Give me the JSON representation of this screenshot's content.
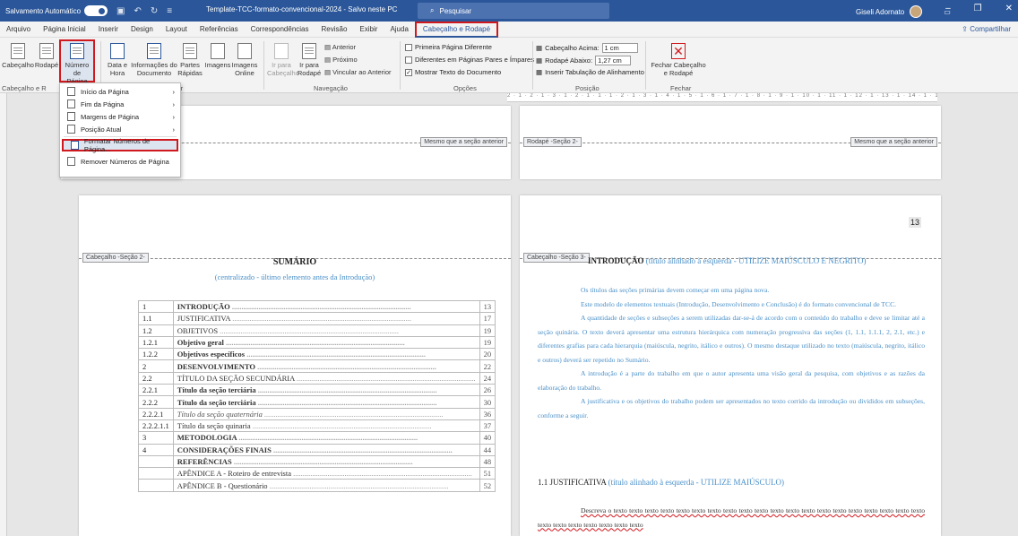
{
  "titlebar": {
    "autosave": "Salvamento Automático",
    "toggle": "Ligado",
    "doc": "Template-TCC-formato-convencional-2024 - Salvo neste PC",
    "search": "Pesquisar",
    "user": "Giseli Adornato"
  },
  "menu": {
    "tabs": [
      "Arquivo",
      "Página Inicial",
      "Inserir",
      "Design",
      "Layout",
      "Referências",
      "Correspondências",
      "Revisão",
      "Exibir",
      "Ajuda"
    ],
    "active": "Cabeçalho e Rodapé",
    "share": "Compartilhar"
  },
  "ribbon": {
    "cabecalho": "Cabeçalho",
    "rodape": "Rodapé",
    "numero": "Número de Página",
    "data": "Data e Hora",
    "info": "Informações do Documento",
    "partes": "Partes Rápidas",
    "imagens": "Imagens",
    "imagens_online": "Imagens Online",
    "ir_cab": "Ir para Cabeçalho",
    "ir_rod": "Ir para Rodapé",
    "anterior": "Anterior",
    "proximo": "Próximo",
    "vincular": "Vincular ao Anterior",
    "primeira": "Primeira Página Diferente",
    "pares": "Diferentes em Páginas Pares e Ímpares",
    "mostrar": "Mostrar Texto do Documento",
    "cab_acima": "Cabeçalho Acima:",
    "cab_val": "1 cm",
    "rod_abaixo": "Rodapé Abaixo:",
    "rod_val": "1,27 cm",
    "tabulacao": "Inserir Tabulação de Alinhamento",
    "fechar": "Fechar Cabeçalho e Rodapé",
    "groups": {
      "g1": "Cabeçalho e R",
      "g2": "ir",
      "nav": "Navegação",
      "opc": "Opções",
      "pos": "Posição",
      "fech": "Fechar"
    }
  },
  "dropdown": [
    "Início da Página",
    "Fim da Página",
    "Margens de Página",
    "Posição Atual",
    "Formatar Números de Página...",
    "Remover Números de Página"
  ],
  "left_page": {
    "tag_top": "Mesmo que a seção anterior",
    "tag_header": "Cabeçalho -Seção 2-",
    "title": "SUMÁRIO",
    "subtitle": "(centralizado - último elemento antes da Introdução)"
  },
  "toc": [
    {
      "n": "1",
      "t": "INTRODUÇÃO",
      "p": "13",
      "s": "b"
    },
    {
      "n": "1.1",
      "t": "JUSTIFICATIVA",
      "p": "17",
      "s": ""
    },
    {
      "n": "1.2",
      "t": "OBJETIVOS",
      "p": "19",
      "s": ""
    },
    {
      "n": "1.2.1",
      "t": "Objetivo geral",
      "p": "19",
      "s": "b"
    },
    {
      "n": "1.2.2",
      "t": "Objetivos específicos",
      "p": "20",
      "s": "b"
    },
    {
      "n": "2",
      "t": "DESENVOLVIMENTO",
      "p": "22",
      "s": "b"
    },
    {
      "n": "2.2",
      "t": "TÍTULO DA SEÇÃO SECUNDÁRIA",
      "p": "24",
      "s": ""
    },
    {
      "n": "2.2.1",
      "t": "Título da seção terciária",
      "p": "26",
      "s": "b"
    },
    {
      "n": "2.2.2",
      "t": "Título da seção terciária",
      "p": "30",
      "s": "b"
    },
    {
      "n": "2.2.2.1",
      "t": "Título da seção quaternária",
      "p": "36",
      "s": "i"
    },
    {
      "n": "2.2.2.1.1",
      "t": "Título da seção quinaria",
      "p": "37",
      "s": ""
    },
    {
      "n": "3",
      "t": "METODOLOGIA",
      "p": "40",
      "s": "b"
    },
    {
      "n": "4",
      "t": "CONSIDERAÇÕES FINAIS",
      "p": "44",
      "s": "b"
    },
    {
      "n": "",
      "t": "REFERÊNCIAS",
      "p": "48",
      "s": "b"
    },
    {
      "n": "",
      "t": "APÊNDICE A - Roteiro de entrevista",
      "p": "51",
      "s": ""
    },
    {
      "n": "",
      "t": "APÊNDICE B - Questionário",
      "p": "52",
      "s": ""
    }
  ],
  "right_page": {
    "tag_footer": "Rodapé -Seção 2-",
    "tag_same": "Mesmo que a seção anterior",
    "page_num": "13",
    "tag_header": "Cabeçalho -Seção 3-",
    "intro_title": "INTRODUÇÃO",
    "intro_note": "(título alinhado à esquerda - UTILIZE MAIÚSCULO E NEGRITO)",
    "p1": "Os títulos das seções primárias devem começar em uma página nova.",
    "p2": "Este modelo de elementos textuais (Introdução, Desenvolvimento e Conclusão) é do formato convencional de TCC.",
    "p3": "A quantidade de seções e subseções a serem utilizadas dar-se-á de acordo com o conteúdo do trabalho e deve se limitar até a seção quinária. O texto deverá apresentar uma estrutura hierárquica com numeração progressiva das seções (1, 1.1, 1.1.1, 2, 2.1, etc.) e diferentes grafias para cada hierarquia (maiúscula, negrito, itálico e outros). O mesmo destaque utilizado no texto (maiúscula, negrito, itálico e outros) deverá ser repetido no Sumário.",
    "p4": "A introdução é a parte do trabalho em que o autor apresenta uma visão geral da pesquisa, com objetivos e as razões da elaboração do trabalho.",
    "p5": "A justificativa e os objetivos do trabalho podem ser apresentados no texto corrido da introdução ou divididos em subseções, conforme a seguir.",
    "just_title": "1.1 JUSTIFICATIVA",
    "just_note": "(título alinhado à esquerda - UTILIZE MAIÚSCULO)",
    "p6": "Descreva o texto texto texto texto texto texto texto texto texto texto texto texto texto texto texto texto texto texto texto texto texto texto texto texto texto texto texto"
  }
}
